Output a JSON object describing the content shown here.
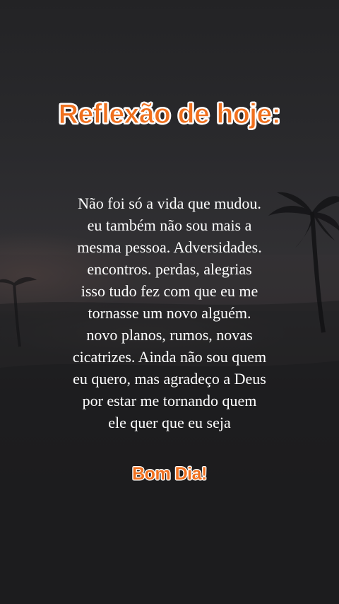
{
  "title": "Reflexão de hoje:",
  "quote_lines": [
    "Não foi só a vida que mudou.",
    "eu também não sou mais a",
    "mesma pessoa. Adversidades.",
    "encontros. perdas, alegrias",
    "isso tudo fez com que eu me",
    "tornasse um novo alguém.",
    "novo planos, rumos, novas",
    "cicatrizes. Ainda não sou quem",
    "eu quero, mas agradeço a Deus",
    "por estar me tornando quem",
    "ele quer que eu seja"
  ],
  "greeting": "Bom Dia!",
  "colors": {
    "accent": "#f0701e",
    "text": "#ffffff",
    "background": "#2a2a2d"
  }
}
